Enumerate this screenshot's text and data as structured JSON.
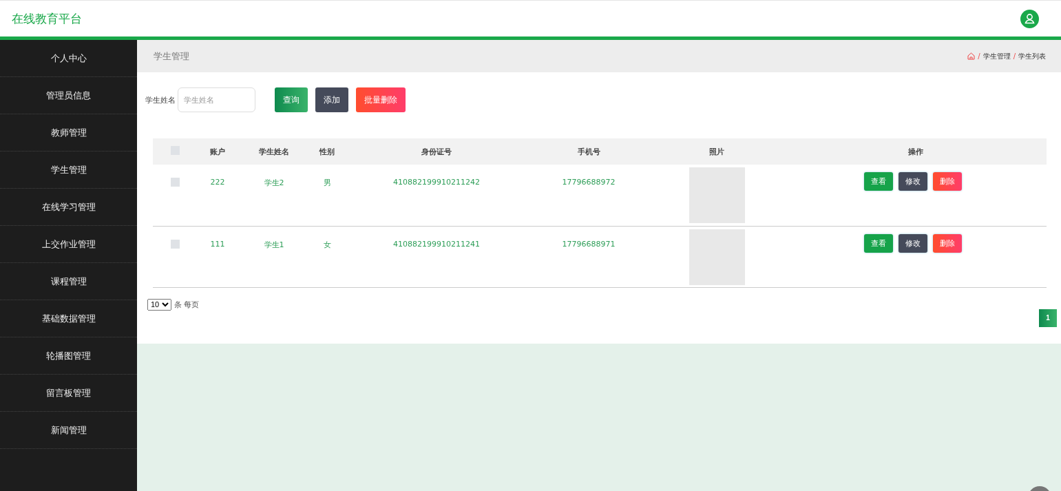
{
  "header": {
    "title": "在线教育平台"
  },
  "sidebar": {
    "items": [
      "个人中心",
      "管理员信息",
      "教师管理",
      "学生管理",
      "在线学习管理",
      "上交作业管理",
      "课程管理",
      "基础数据管理",
      "轮播图管理",
      "留言板管理",
      "新闻管理"
    ]
  },
  "page_title": "学生管理",
  "breadcrumb": [
    {
      "separator": "/",
      "label": "学生管理"
    },
    {
      "separator": "/",
      "label": "学生列表"
    }
  ],
  "search": {
    "label": "学生姓名",
    "placeholder": "学生姓名"
  },
  "toolbar_buttons": [
    {
      "label": "查询",
      "kind": "query"
    },
    {
      "label": "添加",
      "kind": "add"
    },
    {
      "label": "批量删除",
      "kind": "delete"
    }
  ],
  "table": {
    "select_all_checked": false,
    "columns": [
      "账户",
      "学生姓名",
      "性别",
      "身份证号",
      "手机号",
      "照片",
      "操作"
    ],
    "rows": [
      {
        "checked": false,
        "cells": [
          "222",
          "学生2",
          "男",
          "410882199910211242",
          "17796688972"
        ],
        "actions": [
          {
            "label": "查看",
            "kind": "view"
          },
          {
            "label": "修改",
            "kind": "edit"
          },
          {
            "label": "删除",
            "kind": "delete"
          }
        ]
      },
      {
        "checked": false,
        "cells": [
          "111",
          "学生1",
          "女",
          "410882199910211241",
          "17796688971"
        ],
        "actions": [
          {
            "label": "查看",
            "kind": "view"
          },
          {
            "label": "修改",
            "kind": "edit"
          },
          {
            "label": "删除",
            "kind": "delete"
          }
        ]
      }
    ]
  },
  "page_size": {
    "value": "10",
    "label": "条 每页"
  },
  "pages": [
    {
      "label": "1",
      "selected": true
    }
  ]
}
